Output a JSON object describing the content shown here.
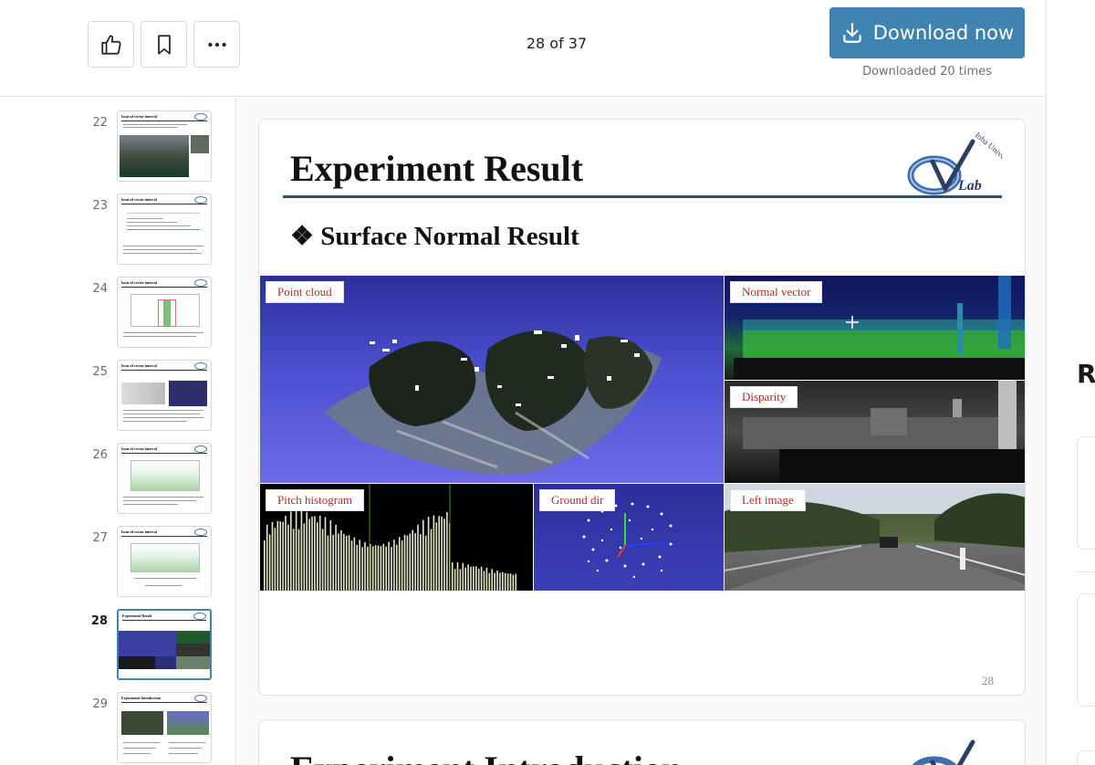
{
  "header": {
    "like_icon": "thumbs-up-icon",
    "save_icon": "bookmark-icon",
    "more_icon": "more-horizontal-icon",
    "page_indicator": "28 of 37",
    "download_label": "Download now",
    "download_icon": "download-icon",
    "download_count": "Downloaded 20 times"
  },
  "sidebar": {
    "thumbnails": [
      {
        "number": "22",
        "title": "Issue of vector interval"
      },
      {
        "number": "23",
        "title": "Issue of vector interval"
      },
      {
        "number": "24",
        "title": "Issue of vector interval"
      },
      {
        "number": "25",
        "title": "Issue of vector interval"
      },
      {
        "number": "26",
        "title": "Issue of vector interval"
      },
      {
        "number": "27",
        "title": "Issue of vector interval"
      },
      {
        "number": "28",
        "title": "Experiment Result",
        "active": true
      },
      {
        "number": "29",
        "title": "Experiment Introduction"
      }
    ]
  },
  "slide": {
    "title": "Experiment Result",
    "subtitle": "❖ Surface Normal Result",
    "logo_text": "Lab",
    "logo_arc_text": "Inha University",
    "page_number": "28",
    "panels": {
      "point_cloud": "Point cloud",
      "normal_vector": "Normal vector",
      "disparity": "Disparity",
      "pitch_histogram": "Pitch histogram",
      "ground_dir": "Ground dir",
      "left_image": "Left image"
    }
  },
  "next_slide": {
    "title": "Experiment Introduction"
  },
  "right_panel": {
    "heading": "Re"
  },
  "colors": {
    "accent": "#3f83b3",
    "label_text": "#b03020"
  }
}
